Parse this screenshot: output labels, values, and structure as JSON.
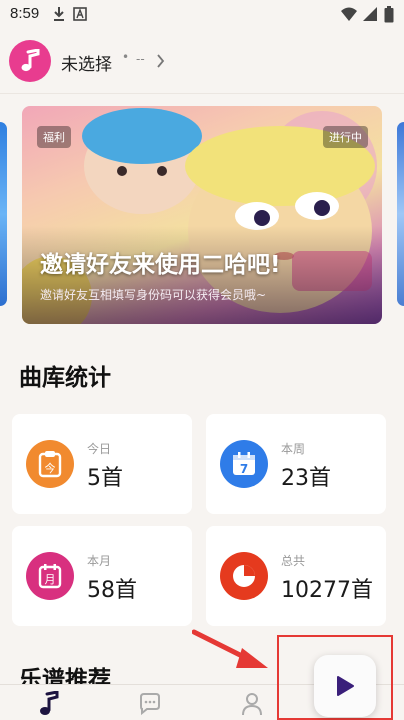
{
  "status_bar": {
    "time": "8:59",
    "icons": [
      "download-icon",
      "a-box-icon",
      "wifi-icon",
      "signal-icon",
      "battery-icon"
    ]
  },
  "header": {
    "title": "未选择",
    "separator": "•",
    "subtitle": "--"
  },
  "banner": {
    "tag_left": "福利",
    "tag_right": "进行中",
    "title": "邀请好友来使用二哈吧!",
    "subtitle": "邀请好友互相填写身份码可以获得会员哦~"
  },
  "stats": {
    "title": "曲库统计",
    "cards": [
      {
        "label": "今日",
        "value": "5首",
        "icon": "clipboard-today-icon",
        "color": "#f18a2f",
        "glyph": "今"
      },
      {
        "label": "本周",
        "value": "23首",
        "icon": "calendar-week-icon",
        "color": "#2f7ce8",
        "glyph": "7"
      },
      {
        "label": "本月",
        "value": "58首",
        "icon": "calendar-month-icon",
        "color": "#d8307f",
        "glyph": "月"
      },
      {
        "label": "总共",
        "value": "10277首",
        "icon": "pie-chart-icon",
        "color": "#e53a1e",
        "glyph": ""
      }
    ]
  },
  "recommend": {
    "title": "乐谱推荐"
  },
  "bottom_nav": {
    "items": [
      "music-note-icon",
      "chat-icon",
      "profile-icon"
    ]
  },
  "colors": {
    "accent": "#e83c8f",
    "play": "#3a1f7a",
    "highlight": "#e53935"
  }
}
